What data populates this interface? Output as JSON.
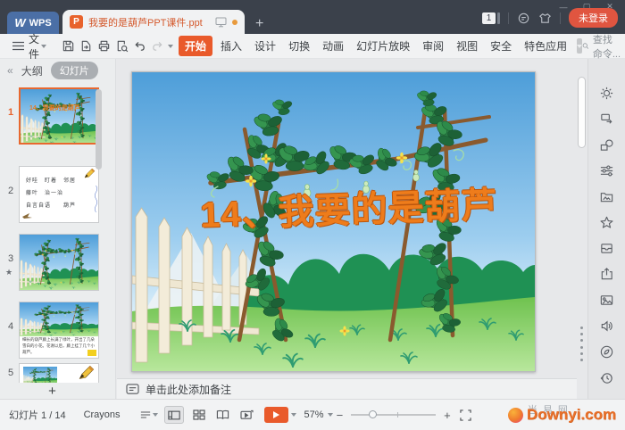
{
  "titlebar": {
    "logo_text": "WPS",
    "doc_title": "我要的是葫芦PPT课件.ppt",
    "new_tab": "+",
    "notification_badge": "1",
    "login": "未登录",
    "minimize": "—",
    "maximize": "▢",
    "close": "✕"
  },
  "menubar": {
    "file": "文件",
    "tabs": [
      "开始",
      "插入",
      "设计",
      "切换",
      "动画",
      "幻灯片放映",
      "审阅",
      "视图",
      "安全",
      "特色应用"
    ],
    "search": "查找命令...",
    "help": "?"
  },
  "panel": {
    "collapse": "«",
    "outline_tab": "大纲",
    "slides_tab": "幻灯片",
    "add_slide": "+",
    "thumbs": {
      "t1": {
        "n": "1"
      },
      "t2": {
        "n": "2",
        "line1": "好哇　盯着　邻居",
        "line2": "藤叶　治一治",
        "line3": "自言自语　　葫芦"
      },
      "t3": {
        "n": "3",
        "star": "★"
      },
      "t4": {
        "n": "4",
        "caption": "细长的葫芦藤上长满了绿叶，开出了几朵雪白的小花。花谢以后，藤上挂了几个小葫芦。"
      },
      "t5": {
        "n": "5"
      }
    }
  },
  "slide": {
    "title": "14、我要的是葫芦"
  },
  "notes": {
    "placeholder": "单击此处添加备注"
  },
  "statusbar": {
    "counter": "幻灯片 1 / 14",
    "theme": "Crayons",
    "zoom": "57%",
    "zoom_out": "−",
    "zoom_in": "+"
  },
  "watermark": {
    "site": "Downyi.com",
    "site_cn": "当易网"
  }
}
